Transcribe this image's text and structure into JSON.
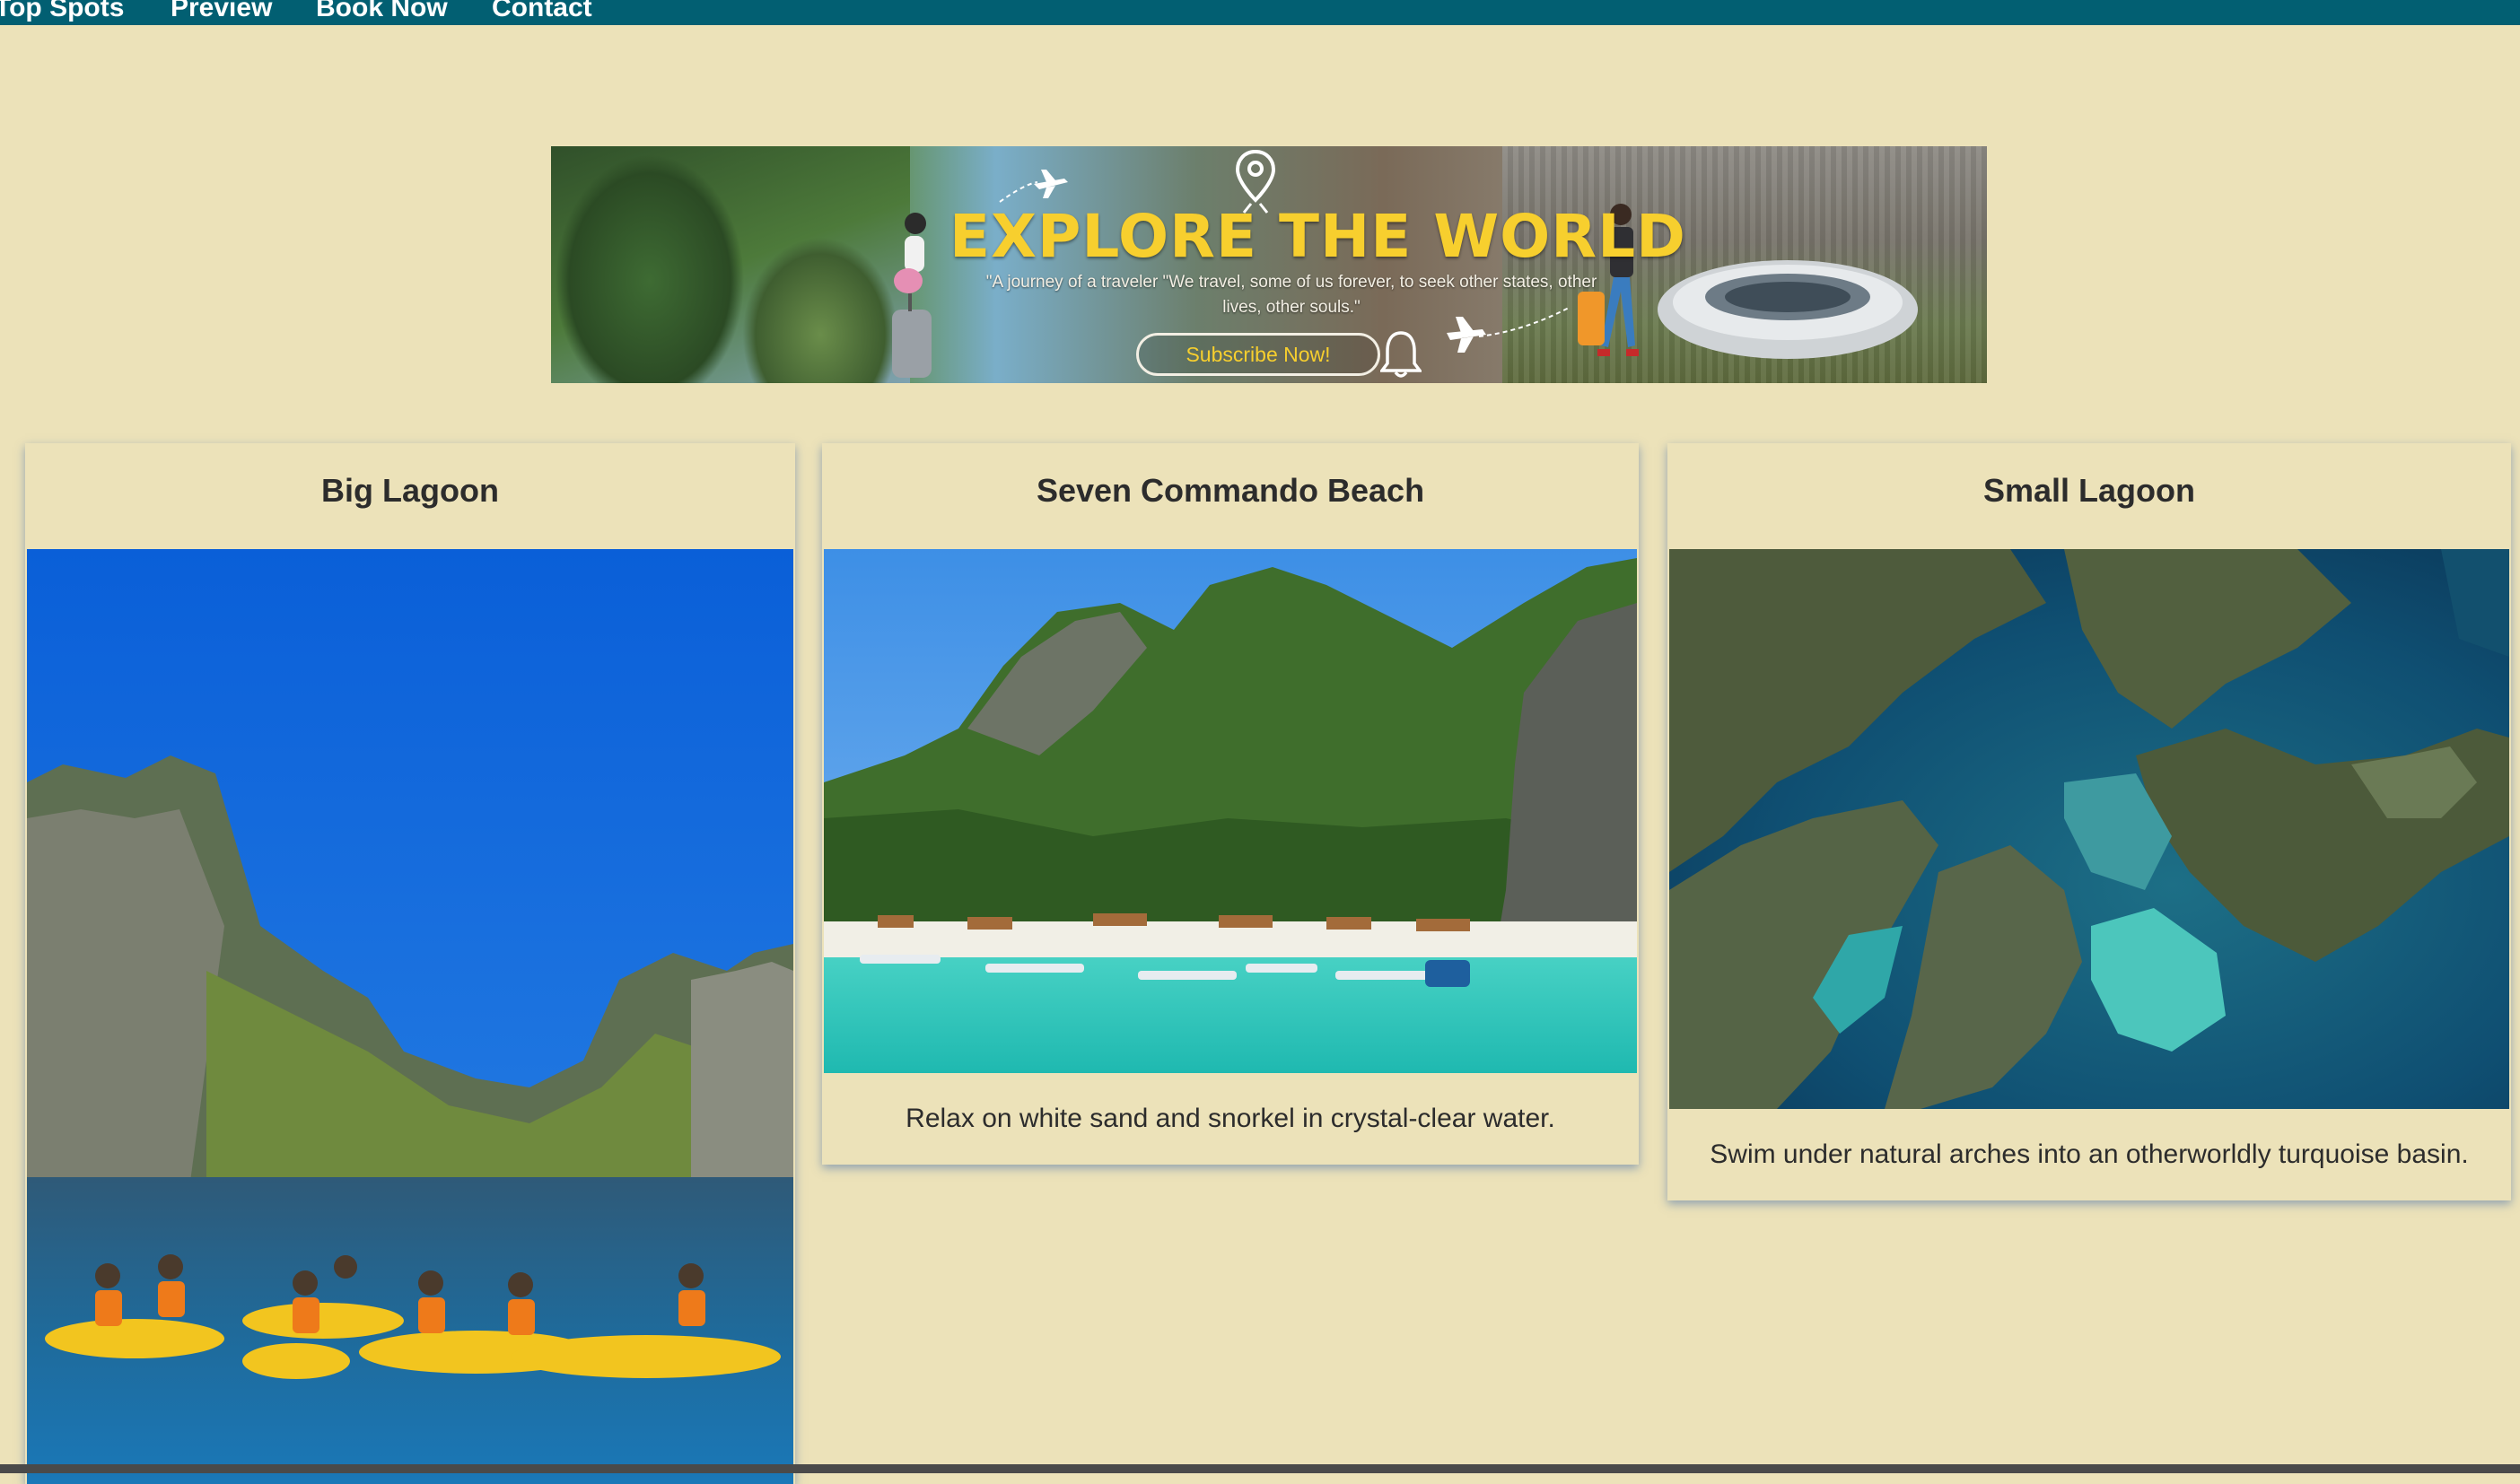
{
  "nav": {
    "items": [
      "Top Spots",
      "Preview",
      "Book Now",
      "Contact"
    ]
  },
  "banner": {
    "title": "EXPLORE THE WORLD",
    "quote": "\"A journey of a traveler \"We travel, some of us forever, to seek other states, other lives, other souls.\"",
    "button_label": "Subscribe Now!"
  },
  "cards": [
    {
      "title": "Big Lagoon",
      "description": ""
    },
    {
      "title": "Seven Commando Beach",
      "description": "Relax on white sand and snorkel in crystal-clear water."
    },
    {
      "title": "Small Lagoon",
      "description": "Swim under natural arches into an otherworldly turquoise basin."
    }
  ],
  "colors": {
    "page_background": "#ece2b9",
    "nav_background": "#025f72",
    "banner_title": "#f7cf2e"
  }
}
